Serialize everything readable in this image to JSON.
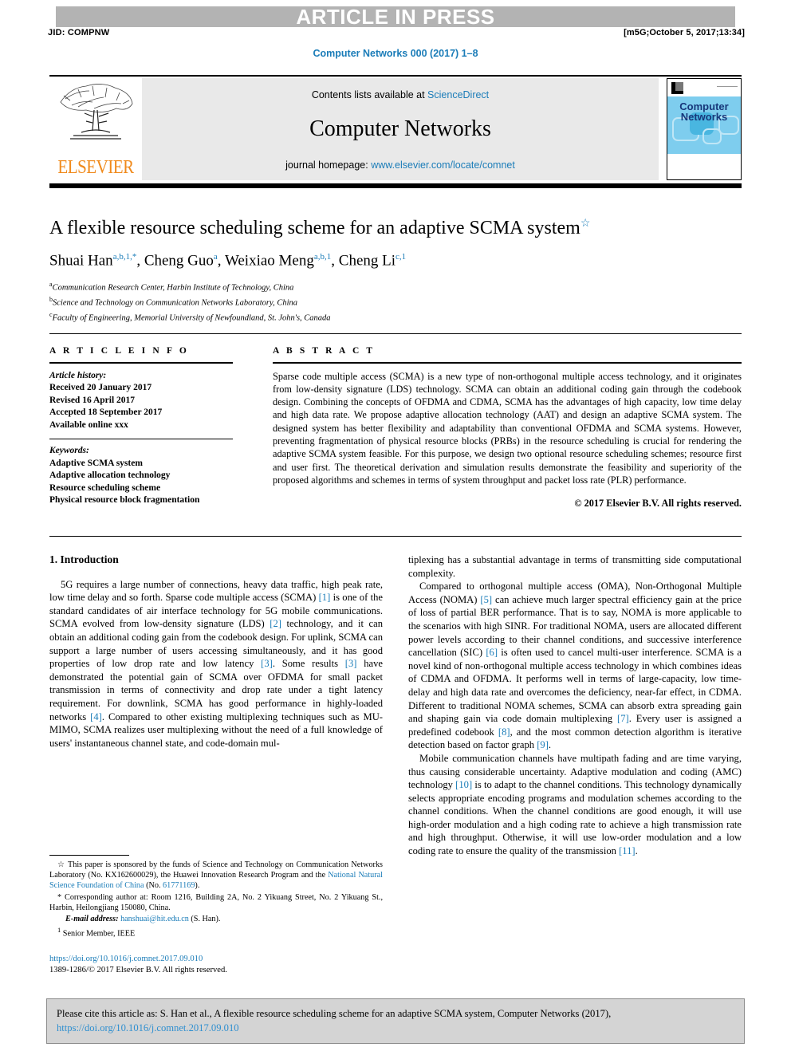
{
  "header": {
    "article_in_press": "ARTICLE IN PRESS",
    "jid": "JID: COMPNW",
    "stamp": "[m5G;October 5, 2017;13:34]",
    "journal_ref": "Computer Networks 000 (2017) 1–8"
  },
  "masthead": {
    "publisher": "ELSEVIER",
    "contents_prefix": "Contents lists available at ",
    "contents_link": "ScienceDirect",
    "journal_name": "Computer Networks",
    "homepage_prefix": "journal homepage: ",
    "homepage_link": "www.elsevier.com/locate/comnet",
    "cover_title_line1": "Computer",
    "cover_title_line2": "Networks"
  },
  "article": {
    "title": "A flexible resource scheduling scheme for an adaptive SCMA system",
    "title_marker": "☆",
    "authors_html": "Shuai Han<sup>a,b,1,*</sup>, Cheng Guo<sup>a</sup>, Weixiao Meng<sup>a,b,1</sup>, Cheng Li<sup>c,1</sup>",
    "affiliations": [
      {
        "mark": "a",
        "text": "Communication Research Center, Harbin Institute of Technology, China"
      },
      {
        "mark": "b",
        "text": "Science and Technology on Communication Networks Laboratory, China"
      },
      {
        "mark": "c",
        "text": "Faculty of Engineering, Memorial University of Newfoundland, St. John's, Canada"
      }
    ]
  },
  "article_info": {
    "heading": "A R T I C L E    I N F O",
    "history_label": "Article history:",
    "history": [
      "Received 20 January 2017",
      "Revised 16 April 2017",
      "Accepted 18 September 2017",
      "Available online xxx"
    ],
    "keywords_label": "Keywords:",
    "keywords": [
      "Adaptive SCMA system",
      "Adaptive allocation technology",
      "Resource scheduling scheme",
      "Physical resource block fragmentation"
    ]
  },
  "abstract": {
    "heading": "A B S T R A C T",
    "text": "Sparse code multiple access (SCMA) is a new type of non-orthogonal multiple access technology, and it originates from low-density signature (LDS) technology. SCMA can obtain an additional coding gain through the codebook design. Combining the concepts of OFDMA and CDMA, SCMA has the advantages of high capacity, low time delay and high data rate. We propose adaptive allocation technology (AAT) and design an adaptive SCMA system. The designed system has better flexibility and adaptability than conventional OFDMA and SCMA systems. However, preventing fragmentation of physical resource blocks (PRBs) in the resource scheduling is crucial for rendering the adaptive SCMA system feasible. For this purpose, we design two optional resource scheduling schemes; resource first and user first. The theoretical derivation and simulation results demonstrate the feasibility and superiority of the proposed algorithms and schemes in terms of system throughput and packet loss rate (PLR) performance.",
    "copyright": "© 2017 Elsevier B.V. All rights reserved."
  },
  "body": {
    "section_heading": "1. Introduction",
    "left_paragraph_1_html": "5G requires a large number of connections, heavy data traffic, high peak rate, low time delay and so forth. Sparse code multiple access (SCMA) <span class=\"ref\">[1]</span> is one of the standard candidates of air interface technology for 5G mobile communications. SCMA evolved from low-density signature (LDS) <span class=\"ref\">[2]</span> technology, and it can obtain an additional coding gain from the codebook design. For uplink, SCMA can support a large number of users accessing simultaneously, and it has good properties of low drop rate and low latency <span class=\"ref\">[3]</span>. Some results <span class=\"ref\">[3]</span> have demonstrated the potential gain of SCMA over OFDMA for small packet transmission in terms of connectivity and drop rate under a tight latency requirement. For downlink, SCMA has good performance in highly-loaded networks <span class=\"ref\">[4]</span>. Compared to other existing multiplexing techniques such as MU-MIMO, SCMA realizes user multiplexing without the need of a full knowledge of users' instantaneous channel state, and code-domain mul-",
    "right_paragraph_1_html": "tiplexing has a substantial advantage in terms of transmitting side computational complexity.",
    "right_paragraph_2_html": "Compared to orthogonal multiple access (OMA), Non-Orthogonal Multiple Access (NOMA) <span class=\"ref\">[5]</span> can achieve much larger spectral efficiency gain at the price of loss of partial BER performance. That is to say, NOMA is more applicable to the scenarios with high SINR. For traditional NOMA, users are allocated different power levels according to their channel conditions, and successive interference cancellation (SIC) <span class=\"ref\">[6]</span> is often used to cancel multi-user interference. SCMA is a novel kind of non-orthogonal multiple access technology in which combines ideas of CDMA and OFDMA. It performs well in terms of large-capacity, low time-delay and high data rate and overcomes the deficiency, near-far effect, in CDMA. Different to traditional NOMA schemes, SCMA can absorb extra spreading gain and shaping gain via code domain multiplexing <span class=\"ref\">[7]</span>. Every user is assigned a predefined codebook <span class=\"ref\">[8]</span>, and the most common detection algorithm is iterative detection based on factor graph <span class=\"ref\">[9]</span>.",
    "right_paragraph_3_html": "Mobile communication channels have multipath fading and are time varying, thus causing considerable uncertainty. Adaptive modulation and coding (AMC) technology <span class=\"ref\">[10]</span> is to adapt to the channel conditions. This technology dynamically selects appropriate encoding programs and modulation schemes according to the channel conditions. When the channel conditions are good enough, it will use high-order modulation and a high coding rate to achieve a high transmission rate and high throughput. Otherwise, it will use low-order modulation and a low coding rate to ensure the quality of the transmission <span class=\"ref\">[11]</span>."
  },
  "footnotes": {
    "funding_html": "<span>☆</span> This paper is sponsored by the funds of Science and Technology on Communication Networks Laboratory (No. KX162600029), the Huawei Innovation Research Program and the <span class=\"lnk\">National Natural Science Foundation of China</span> (No. <span class=\"lnk\">61771169</span>).",
    "corresponding_html": "<span>*</span> Corresponding author at: Room 1216, Building 2A, No. 2 Yikuang Street, No. 2 Yikuang St., Harbin, Heilongjiang 150080, China.",
    "email_html": "<span class=\"em\">E-mail address:</span> <span class=\"lnk\">hanshuai@hit.edu.cn</span> (S. Han).",
    "member_html": "<sup>1</sup> Senior Member, IEEE"
  },
  "doi_block": {
    "doi_link": "https://doi.org/10.1016/j.comnet.2017.09.010",
    "issn_line": "1389-1286/© 2017 Elsevier B.V. All rights reserved."
  },
  "citation_box": {
    "text": "Please cite this article as: S. Han et al., A flexible resource scheduling scheme for an adaptive SCMA system, Computer Networks (2017),",
    "link": "https://doi.org/10.1016/j.comnet.2017.09.010"
  }
}
